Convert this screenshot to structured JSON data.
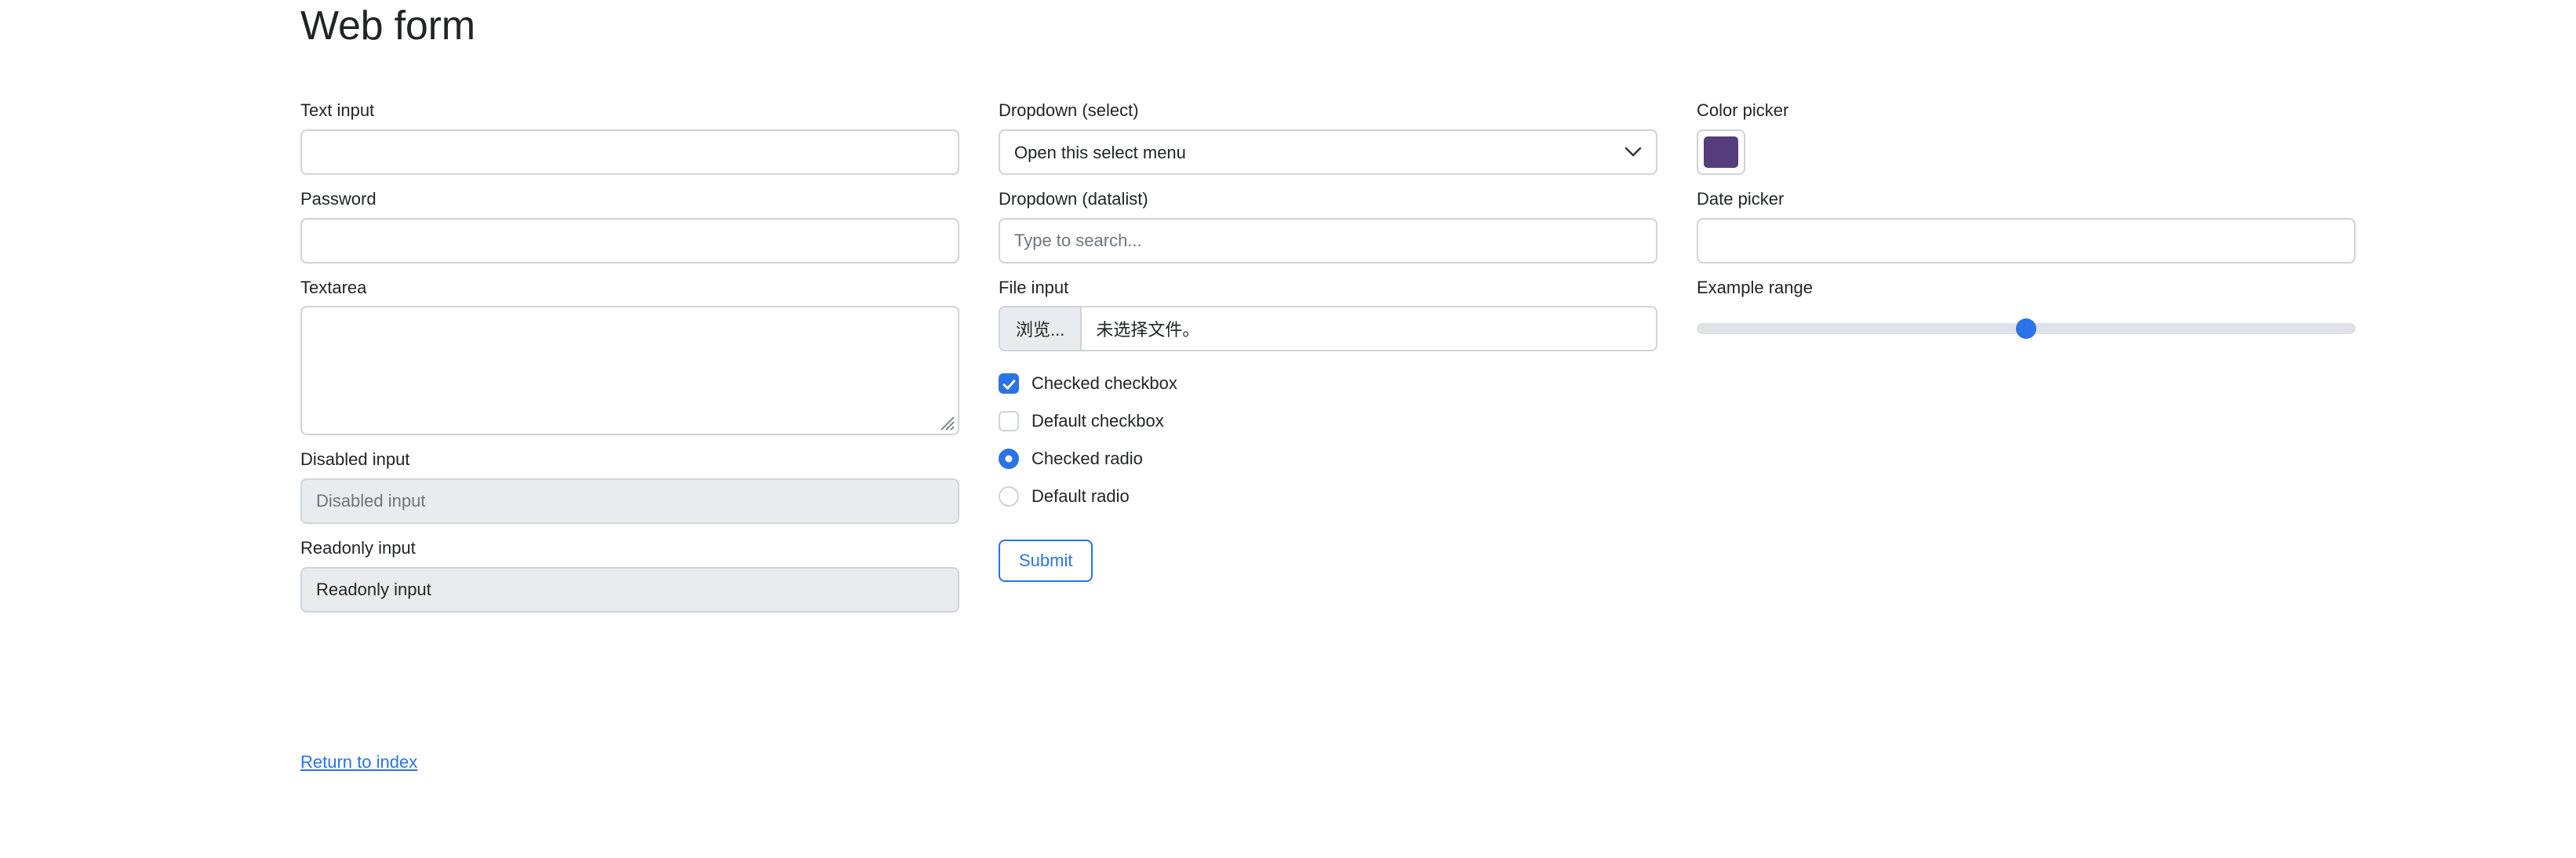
{
  "page": {
    "title": "Web form"
  },
  "column_left": {
    "text_input": {
      "label": "Text input",
      "value": "",
      "placeholder": ""
    },
    "password": {
      "label": "Password",
      "value": "",
      "placeholder": ""
    },
    "textarea": {
      "label": "Textarea",
      "value": "",
      "placeholder": ""
    },
    "disabled_input": {
      "label": "Disabled input",
      "value": "",
      "placeholder": "Disabled input"
    },
    "readonly_input": {
      "label": "Readonly input",
      "value": "Readonly input",
      "placeholder": ""
    }
  },
  "column_middle": {
    "select": {
      "label": "Dropdown (select)",
      "selected": "Open this select menu",
      "options": [
        "Open this select menu"
      ],
      "chevron_icon": "chevron-down-icon"
    },
    "datalist": {
      "label": "Dropdown (datalist)",
      "value": "",
      "placeholder": "Type to search..."
    },
    "file_input": {
      "label": "File input",
      "button_label": "浏览...",
      "status_text": "未选择文件。"
    },
    "checks": [
      {
        "type": "checkbox",
        "label": "Checked checkbox",
        "checked": true
      },
      {
        "type": "checkbox",
        "label": "Default checkbox",
        "checked": false
      },
      {
        "type": "radio",
        "label": "Checked radio",
        "checked": true
      },
      {
        "type": "radio",
        "label": "Default radio",
        "checked": false
      }
    ],
    "submit": {
      "label": "Submit"
    }
  },
  "column_right": {
    "color_picker": {
      "label": "Color picker",
      "value": "#563d7c"
    },
    "date_picker": {
      "label": "Date picker",
      "value": "",
      "placeholder": ""
    },
    "range": {
      "label": "Example range",
      "value": 50,
      "min": 0,
      "max": 100
    }
  },
  "footer": {
    "return_link": "Return to index"
  },
  "colors": {
    "accent": "#2b73e8",
    "link": "#2b73e8",
    "border": "#ced4da",
    "muted_bg": "#e9ecef",
    "text": "#212529",
    "placeholder": "#6c757d",
    "swatch": "#563d7c"
  }
}
